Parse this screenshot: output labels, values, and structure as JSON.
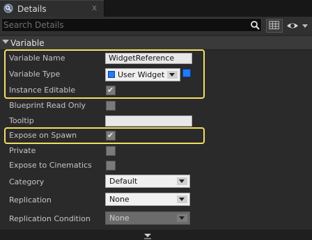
{
  "tab": {
    "title": "Details",
    "icon": "details-search-icon",
    "close": "x"
  },
  "search": {
    "placeholder": "Search Details",
    "value": ""
  },
  "section": {
    "title": "Variable"
  },
  "rows": {
    "variable_name": {
      "label": "Variable Name",
      "value": "WidgetReference"
    },
    "variable_type": {
      "label": "Variable Type",
      "value": "User Widget",
      "color": "#1e7cff"
    },
    "instance_editable": {
      "label": "Instance Editable",
      "checked": true
    },
    "blueprint_read_only": {
      "label": "Blueprint Read Only",
      "checked": false
    },
    "tooltip": {
      "label": "Tooltip",
      "value": ""
    },
    "expose_on_spawn": {
      "label": "Expose on Spawn",
      "checked": true
    },
    "private": {
      "label": "Private",
      "checked": false
    },
    "expose_to_cinematics": {
      "label": "Expose to Cinematics",
      "checked": false
    },
    "category": {
      "label": "Category",
      "value": "Default"
    },
    "replication": {
      "label": "Replication",
      "value": "None"
    },
    "replication_condition": {
      "label": "Replication Condition",
      "value": "None",
      "disabled": true
    }
  },
  "highlight_color": "#f1e163"
}
